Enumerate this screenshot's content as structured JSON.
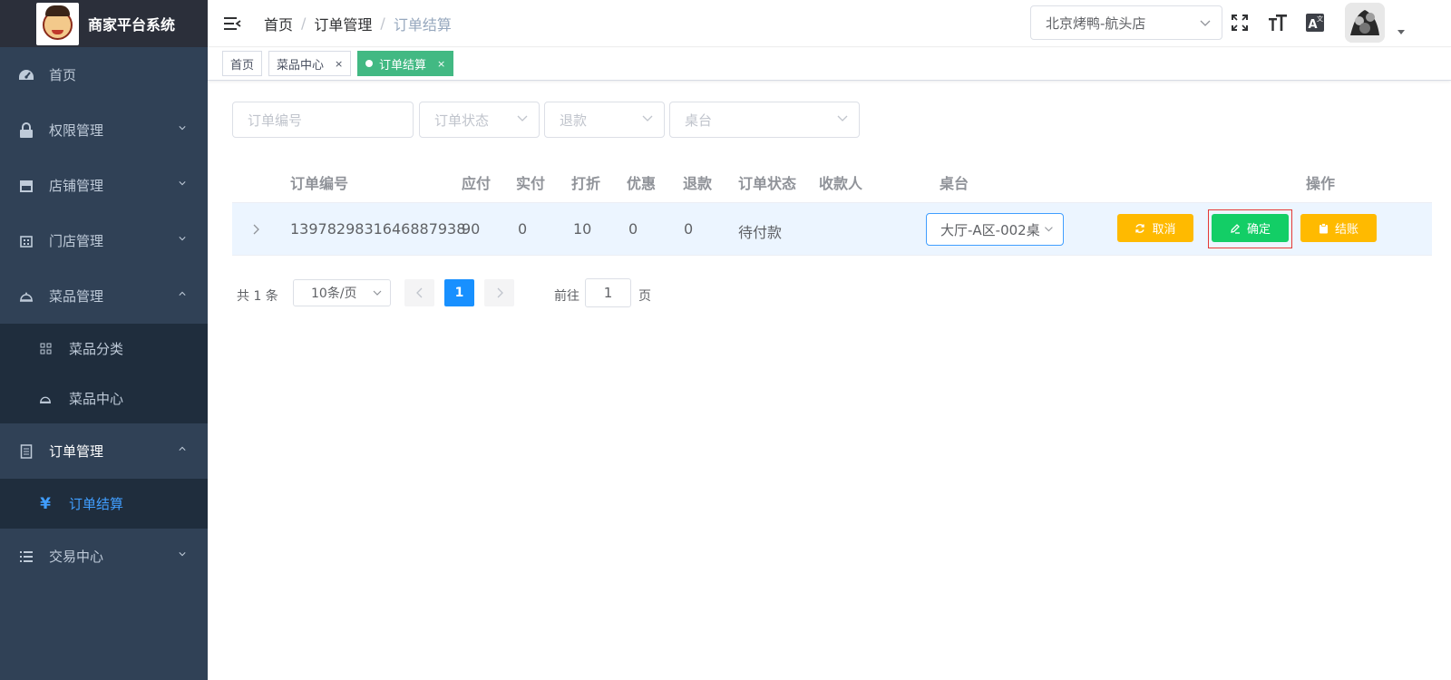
{
  "app": {
    "title": "商家平台系统"
  },
  "sidebar": {
    "items": [
      {
        "label": "首页",
        "icon": "dashboard-icon"
      },
      {
        "label": "权限管理",
        "icon": "lock-icon"
      },
      {
        "label": "店铺管理",
        "icon": "store-icon"
      },
      {
        "label": "门店管理",
        "icon": "building-icon"
      },
      {
        "label": "菜品管理",
        "icon": "cloche-icon"
      },
      {
        "label": "订单管理",
        "icon": "document-icon"
      },
      {
        "label": "交易中心",
        "icon": "list-icon"
      }
    ],
    "dish_sub": [
      {
        "label": "菜品分类",
        "icon": "grid-icon"
      },
      {
        "label": "菜品中心",
        "icon": "cloche-icon"
      }
    ],
    "order_sub": [
      {
        "label": "订单结算",
        "icon": "yen-icon"
      }
    ]
  },
  "header": {
    "breadcrumb": [
      "首页",
      "订单管理",
      "订单结算"
    ],
    "separator": "/",
    "shop": "北京烤鸭-航头店"
  },
  "tags": [
    {
      "label": "首页",
      "closable": false
    },
    {
      "label": "菜品中心",
      "closable": true
    },
    {
      "label": "订单结算",
      "closable": true,
      "active": true
    }
  ],
  "tag_close": "×",
  "filters": {
    "order_no": "订单编号",
    "order_status": "订单状态",
    "refund": "退款",
    "desk": "桌台"
  },
  "table": {
    "columns": [
      "订单编号",
      "应付",
      "实付",
      "打折",
      "优惠",
      "退款",
      "订单状态",
      "收款人",
      "桌台",
      "操作"
    ],
    "rows": [
      {
        "order_no": "1397829831646887938",
        "payable": "90",
        "paid": "0",
        "discount": "10",
        "coupon": "0",
        "refund": "0",
        "status": "待付款",
        "cashier": "",
        "desk": "大厅-A区-002桌",
        "actions": {
          "cancel": "取消",
          "confirm": "确定",
          "checkout": "结账"
        }
      }
    ]
  },
  "pagination": {
    "total_text": "共 1 条",
    "page_size": "10条/页",
    "current_page": "1",
    "goto_label": "前往",
    "goto_value": "1",
    "goto_suffix": "页"
  },
  "colors": {
    "sidebar_bg": "#304156",
    "accent": "#409eff",
    "tag_active": "#42b983",
    "warning": "#ffba00",
    "success": "#13ce66"
  }
}
